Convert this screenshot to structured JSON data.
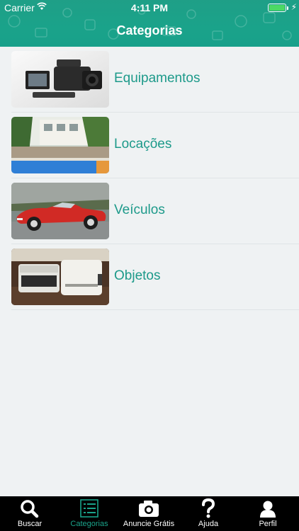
{
  "status_bar": {
    "carrier": "Carrier",
    "time": "4:11 PM"
  },
  "header": {
    "title": "Categorias"
  },
  "categories": [
    {
      "label": "Equipamentos",
      "image": "camera-photo"
    },
    {
      "label": "Locações",
      "image": "pool-house-photo"
    },
    {
      "label": "Veículos",
      "image": "red-car-photo"
    },
    {
      "label": "Objetos",
      "image": "typewriter-photo"
    }
  ],
  "tabbar": {
    "items": [
      {
        "label": "Buscar",
        "icon": "search-icon"
      },
      {
        "label": "Categorias",
        "icon": "list-icon",
        "active": true
      },
      {
        "label": "Anuncie Grátis",
        "icon": "camera-icon"
      },
      {
        "label": "Ajuda",
        "icon": "question-icon"
      },
      {
        "label": "Perfil",
        "icon": "person-icon"
      }
    ]
  },
  "colors": {
    "accent": "#1aa38a",
    "header": "#1aa38a",
    "tabbar": "#000000",
    "background": "#eff2f3"
  }
}
